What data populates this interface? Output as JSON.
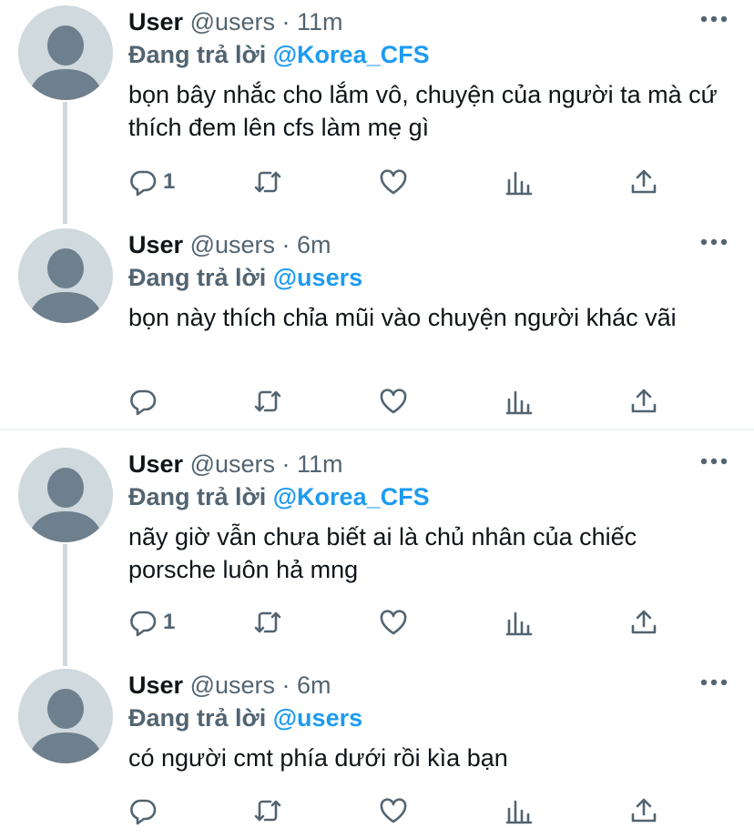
{
  "reply_prefix": "Đang trả lời",
  "tweets": [
    {
      "name": "User",
      "handle": "@users",
      "dot": "·",
      "time": "11m",
      "reply_to": "@Korea_CFS",
      "text": "bọn bây nhắc cho lắm vô, chuyện của người ta mà cứ thích đem lên cfs làm mẹ gì",
      "reply_count": "1"
    },
    {
      "name": "User",
      "handle": "@users",
      "dot": "·",
      "time": "6m",
      "reply_to": "@users",
      "text": "bọn này thích chỉa mũi vào chuyện người khác vãi",
      "reply_count": ""
    },
    {
      "name": "User",
      "handle": "@users",
      "dot": "·",
      "time": "11m",
      "reply_to": "@Korea_CFS",
      "text": "nãy giờ vẫn chưa biết ai là chủ nhân của chiếc porsche luôn hả mng",
      "reply_count": "1"
    },
    {
      "name": "User",
      "handle": "@users",
      "dot": "·",
      "time": "6m",
      "reply_to": "@users",
      "text": "có người cmt phía dưới rồi kìa bạn",
      "reply_count": ""
    }
  ],
  "colors": {
    "mention": "#1d9bf0",
    "secondary": "#536471",
    "avatar_bg": "#cfd9de",
    "avatar_fg": "#6e7f8d"
  },
  "icons": [
    "more-icon",
    "reply-icon",
    "retweet-icon",
    "like-icon",
    "views-icon",
    "share-icon",
    "avatar-placeholder-icon"
  ]
}
